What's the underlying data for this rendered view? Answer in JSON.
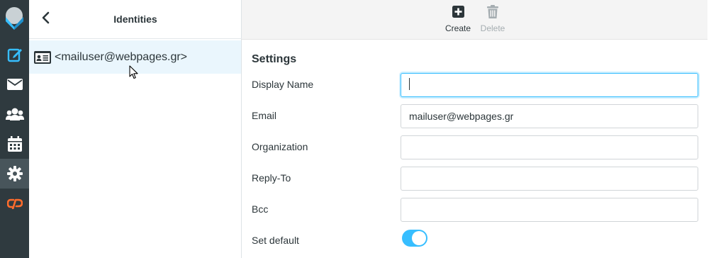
{
  "rail": {
    "items": [
      {
        "name": "compose-icon"
      },
      {
        "name": "mail-icon"
      },
      {
        "name": "contacts-icon"
      },
      {
        "name": "calendar-icon"
      },
      {
        "name": "settings-icon",
        "active": true
      },
      {
        "name": "cpanel-icon"
      }
    ]
  },
  "list": {
    "title": "Identities",
    "identity": "<mailuser@webpages.gr>"
  },
  "toolbar": {
    "create_label": "Create",
    "delete_label": "Delete"
  },
  "settings": {
    "title": "Settings",
    "fields": {
      "display_name": {
        "label": "Display Name",
        "value": ""
      },
      "email": {
        "label": "Email",
        "value": "mailuser@webpages.gr"
      },
      "organization": {
        "label": "Organization",
        "value": ""
      },
      "reply_to": {
        "label": "Reply-To",
        "value": ""
      },
      "bcc": {
        "label": "Bcc",
        "value": ""
      }
    },
    "set_default": {
      "label": "Set default",
      "checked": true
    }
  },
  "colors": {
    "rail_bg": "#2f3a3f",
    "accent": "#37beff",
    "cpanel": "#ff6c2c",
    "selected_row": "#eaf6fd"
  }
}
